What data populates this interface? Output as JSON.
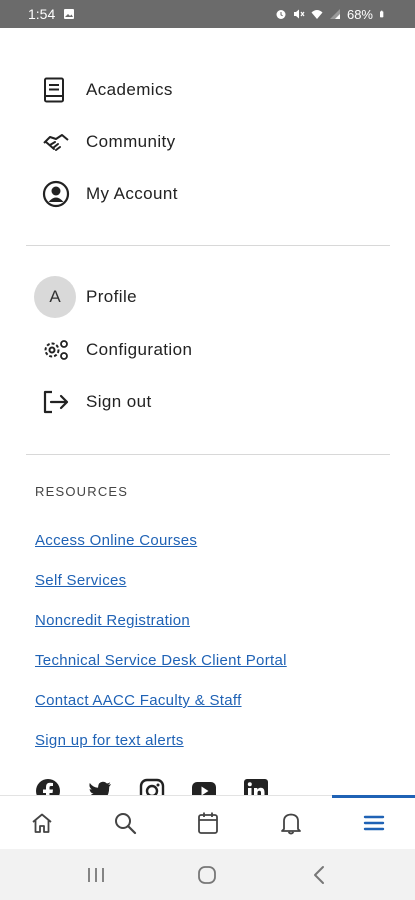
{
  "status_bar": {
    "time": "1:54",
    "battery": "68%"
  },
  "nav": {
    "primary": [
      {
        "label": "Academics",
        "icon": "book-icon"
      },
      {
        "label": "Community",
        "icon": "handshake-icon"
      },
      {
        "label": "My Account",
        "icon": "account-circle-icon"
      }
    ],
    "secondary": [
      {
        "label": "Profile",
        "icon": "avatar",
        "avatar_letter": "A"
      },
      {
        "label": "Configuration",
        "icon": "gears-icon"
      },
      {
        "label": "Sign out",
        "icon": "sign-out-icon"
      }
    ]
  },
  "resources": {
    "title": "RESOURCES",
    "links": [
      "Access Online Courses",
      "Self Services",
      "Noncredit Registration",
      "Technical Service Desk Client Portal",
      "Contact AACC Faculty & Staff",
      "Sign up for text alerts"
    ]
  },
  "social": [
    "facebook-icon",
    "twitter-icon",
    "instagram-icon",
    "youtube-icon",
    "linkedin-icon"
  ],
  "tabbar": {
    "tabs": [
      "home-icon",
      "search-icon",
      "calendar-icon",
      "bell-icon",
      "menu-icon"
    ],
    "active": "menu-icon",
    "accent": "#1f62b5"
  },
  "colors": {
    "link": "#1f62b5",
    "status_bar": "#6b6b6b"
  }
}
